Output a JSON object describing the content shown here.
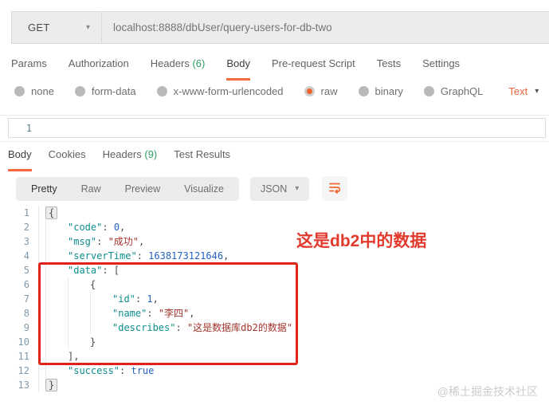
{
  "request": {
    "method": "GET",
    "url": "localhost:8888/dbUser/query-users-for-db-two",
    "tabs": [
      {
        "label": "Params"
      },
      {
        "label": "Authorization"
      },
      {
        "label": "Headers",
        "count": "(6)"
      },
      {
        "label": "Body",
        "active": true
      },
      {
        "label": "Pre-request Script"
      },
      {
        "label": "Tests"
      },
      {
        "label": "Settings"
      }
    ],
    "body_modes": [
      {
        "label": "none"
      },
      {
        "label": "form-data"
      },
      {
        "label": "x-www-form-urlencoded"
      },
      {
        "label": "raw",
        "selected": true
      },
      {
        "label": "binary"
      },
      {
        "label": "GraphQL"
      }
    ],
    "raw_type_label": "Text",
    "editor_lines": [
      "1"
    ]
  },
  "response": {
    "tabs": [
      {
        "label": "Body",
        "active": true
      },
      {
        "label": "Cookies"
      },
      {
        "label": "Headers",
        "count": "(9)"
      },
      {
        "label": "Test Results"
      }
    ],
    "view_tabs": [
      {
        "label": "Pretty",
        "active": true
      },
      {
        "label": "Raw"
      },
      {
        "label": "Preview"
      },
      {
        "label": "Visualize"
      }
    ],
    "format_label": "JSON",
    "code_lines": [
      {
        "n": "1",
        "indent": 0,
        "tokens": [
          {
            "t": "brace",
            "v": "{"
          }
        ]
      },
      {
        "n": "2",
        "indent": 1,
        "tokens": [
          {
            "t": "key",
            "v": "\"code\""
          },
          {
            "t": "punc",
            "v": ": "
          },
          {
            "t": "num",
            "v": "0"
          },
          {
            "t": "punc",
            "v": ","
          }
        ]
      },
      {
        "n": "3",
        "indent": 1,
        "tokens": [
          {
            "t": "key",
            "v": "\"msg\""
          },
          {
            "t": "punc",
            "v": ": "
          },
          {
            "t": "str",
            "v": "\"成功\""
          },
          {
            "t": "punc",
            "v": ","
          }
        ]
      },
      {
        "n": "4",
        "indent": 1,
        "tokens": [
          {
            "t": "key",
            "v": "\"serverTime\""
          },
          {
            "t": "punc",
            "v": ": "
          },
          {
            "t": "num",
            "v": "1638173121646"
          },
          {
            "t": "punc",
            "v": ","
          }
        ]
      },
      {
        "n": "5",
        "indent": 1,
        "tokens": [
          {
            "t": "key",
            "v": "\"data\""
          },
          {
            "t": "punc",
            "v": ": ["
          }
        ]
      },
      {
        "n": "6",
        "indent": 2,
        "tokens": [
          {
            "t": "punc",
            "v": "{"
          }
        ]
      },
      {
        "n": "7",
        "indent": 3,
        "tokens": [
          {
            "t": "key",
            "v": "\"id\""
          },
          {
            "t": "punc",
            "v": ": "
          },
          {
            "t": "num",
            "v": "1"
          },
          {
            "t": "punc",
            "v": ","
          }
        ]
      },
      {
        "n": "8",
        "indent": 3,
        "tokens": [
          {
            "t": "key",
            "v": "\"name\""
          },
          {
            "t": "punc",
            "v": ": "
          },
          {
            "t": "str",
            "v": "\"李四\""
          },
          {
            "t": "punc",
            "v": ","
          }
        ]
      },
      {
        "n": "9",
        "indent": 3,
        "tokens": [
          {
            "t": "key",
            "v": "\"describes\""
          },
          {
            "t": "punc",
            "v": ": "
          },
          {
            "t": "str",
            "v": "\"这是数据库db2的数据\""
          }
        ]
      },
      {
        "n": "10",
        "indent": 2,
        "tokens": [
          {
            "t": "punc",
            "v": "}"
          }
        ]
      },
      {
        "n": "11",
        "indent": 1,
        "tokens": [
          {
            "t": "punc",
            "v": "],"
          }
        ]
      },
      {
        "n": "12",
        "indent": 1,
        "tokens": [
          {
            "t": "key",
            "v": "\"success\""
          },
          {
            "t": "punc",
            "v": ": "
          },
          {
            "t": "bool",
            "v": "true"
          }
        ]
      },
      {
        "n": "13",
        "indent": 0,
        "tokens": [
          {
            "t": "brace",
            "v": "}"
          }
        ]
      }
    ]
  },
  "annotation": {
    "label": "这是db2中的数据"
  },
  "watermark": "@稀土掘金技术社区",
  "colors": {
    "accent_orange": "#f26b3b",
    "count_green": "#2f9e63",
    "key_teal": "#0d8d8d",
    "number_blue": "#2563c4",
    "string_red": "#a5342c",
    "annotation_red": "#e23a2d"
  }
}
